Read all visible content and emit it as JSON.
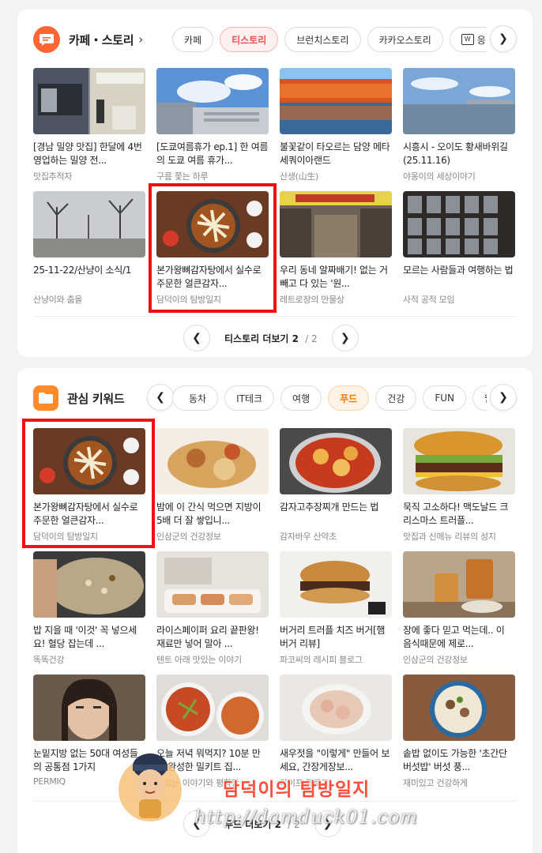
{
  "story_section": {
    "title": "카페・스토리",
    "tabs": [
      "카페",
      "티스토리",
      "브런치스토리",
      "카카오스토리",
      "응"
    ],
    "active_tab": 1,
    "items": [
      {
        "title": "[경남 밀양 맛집] 한달에 4번 영업하는 밀양 전...",
        "source": "맛집추적자"
      },
      {
        "title": "[도쿄여름휴가 ep.1] 한 여름의 도쿄 여름 휴가...",
        "source": "구름 쫓는 하루"
      },
      {
        "title": "불꽃같이 타오르는 담양 메타세쿼이아랜드",
        "source": "산생(山生)"
      },
      {
        "title": "시흥시 - 오이도 황새바위길 (25.11.16)",
        "source": "야옹이의 세상이야기"
      },
      {
        "title": "25-11-22/산냥이 소식/1",
        "source": "산냥이와 춤을"
      },
      {
        "title": "본가왕뼈감자탕에서 실수로 주문한 얼큰감자...",
        "source": "담덕이의 탐방일지"
      },
      {
        "title": "우리 동네 알짜배기! 없는 거 빼고 다 있는 '원...",
        "source": "레트로장의 만물상"
      },
      {
        "title": "모르는 사람들과 여행하는 법",
        "source": "사적 공적 모임"
      }
    ],
    "more_label": "티스토리 더보기",
    "page_current": "2",
    "page_total": "/ 2"
  },
  "keyword_section": {
    "title": "관심 키워드",
    "tabs": [
      "동차",
      "IT테크",
      "여행",
      "푸드",
      "건강",
      "FUN",
      "웹툰"
    ],
    "active_tab": 3,
    "items": [
      {
        "title": "본가왕뼈감자탕에서 실수로 주문한 얼큰감자...",
        "source": "담덕이의 탐방일지"
      },
      {
        "title": "밤에 이 간식 먹으면 지방이 5배 더 잘 쌓입니...",
        "source": "인삼군의 건강정보"
      },
      {
        "title": "감자고추장찌개 만드는 법",
        "source": "감자바우 산약초"
      },
      {
        "title": "묵직 고소하다! 맥도날드 크리스마스 트러플...",
        "source": "맛집과 신메뉴 리뷰의 성지"
      },
      {
        "title": "밥 지을 때 '이것' 꼭 넣으세요! 혈당 잡는데 ...",
        "source": "똑똑건강"
      },
      {
        "title": "라이스페이퍼 요리 끝판왕! 재료만 넣어 말아 ...",
        "source": "텐트 아래 맛있는 이야기"
      },
      {
        "title": "버거리 트러플 치즈 버거[햄버거 리뷰]",
        "source": "파코씨의 레시피 블로그"
      },
      {
        "title": "장에 좋다 믿고 먹는데.. 이 음식때문에 제로...",
        "source": "인삼군의 건강정보"
      },
      {
        "title": "눈밑지방 없는 50대 여성들의 공통점 1가지",
        "source": "PERMIQ"
      },
      {
        "title": "오늘 저녁 뭐먹지? 10분 만에 완성한 밀키트 집...",
        "source": "맛있는 이야기와 평화한"
      },
      {
        "title": "새우젓을 \"이렇게\" 만들어 보세요, 간장게장보...",
        "source": "라이프 블로그"
      },
      {
        "title": "솥밥 없이도 가능한 '초간단 버섯밥' 버섯 풍...",
        "source": "재미있고 건강하게"
      }
    ],
    "more_label": "푸드 더보기",
    "page_current": "2",
    "page_total": "/ 2"
  },
  "watermark": {
    "title": "담덕이의 탐방일지",
    "url": "http://damduck01.com"
  },
  "colors": {
    "highlight": "#ee1111",
    "accent_red": "#f05050",
    "accent_orange": "#ff7a00"
  }
}
